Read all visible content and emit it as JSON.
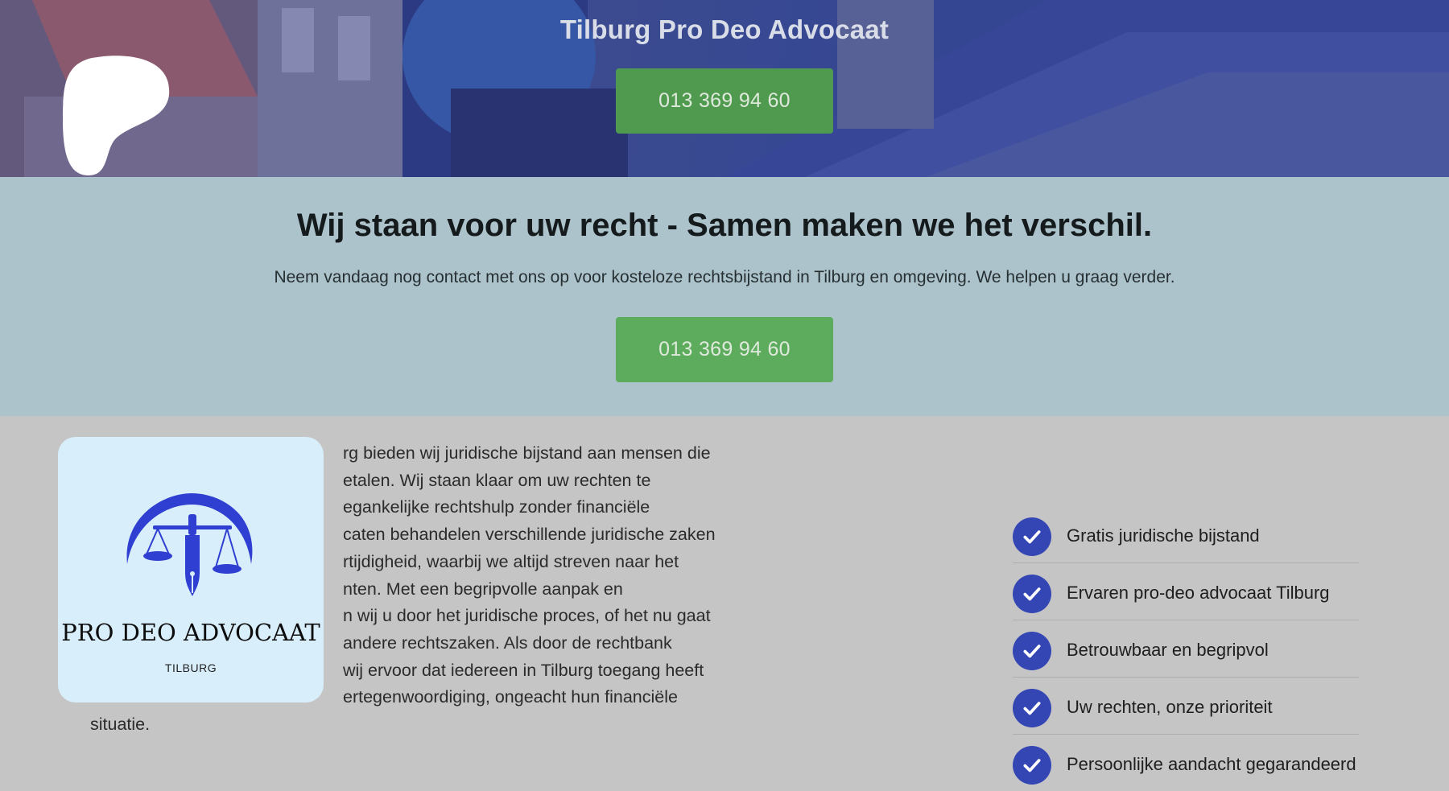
{
  "hero": {
    "title": "Tilburg Pro Deo Advocaat",
    "phone_button": "013 369 94 60"
  },
  "cta": {
    "heading": "Wij staan voor uw recht - Samen maken we het verschil.",
    "text": "Neem vandaag nog contact met ons op voor kosteloze rechtsbijstand in Tilburg en omgeving. We helpen u graag verder.",
    "phone_button": "013 369 94 60"
  },
  "intro": {
    "lines": [
      "rg bieden wij juridische bijstand aan mensen die",
      "etalen. Wij staan klaar om uw rechten te",
      "egankelijke rechtshulp zonder financiële",
      "caten behandelen verschillende juridische zaken",
      "rtijdigheid, waarbij we altijd streven naar het",
      "nten. Met een begripvolle aanpak en",
      "n wij u door het juridische proces, of het nu gaat",
      " andere rechtszaken. Als door de rechtbank",
      " wij ervoor dat iedereen in Tilburg toegang heeft",
      "ertegenwoordiging, ongeacht hun financiële",
      "situatie."
    ]
  },
  "logo": {
    "title": "PRO DEO ADVOCAAT",
    "subtitle": "TILBURG",
    "icon": "scales-of-justice-pen-icon"
  },
  "features": [
    {
      "label": "Gratis juridische bijstand",
      "icon": "check-circle-icon"
    },
    {
      "label": "Ervaren pro-deo advocaat Tilburg",
      "icon": "check-circle-icon"
    },
    {
      "label": "Betrouwbaar en begripvol",
      "icon": "check-circle-icon"
    },
    {
      "label": "Uw rechten, onze prioriteit",
      "icon": "check-circle-icon"
    },
    {
      "label": "Persoonlijke aandacht gegarandeerd",
      "icon": "check-circle-icon"
    }
  ],
  "colors": {
    "button_green": "#5dac5d",
    "cta_band": "#adc3cb",
    "check_blue": "#3446b4",
    "logo_blue": "#2f3fd1"
  }
}
